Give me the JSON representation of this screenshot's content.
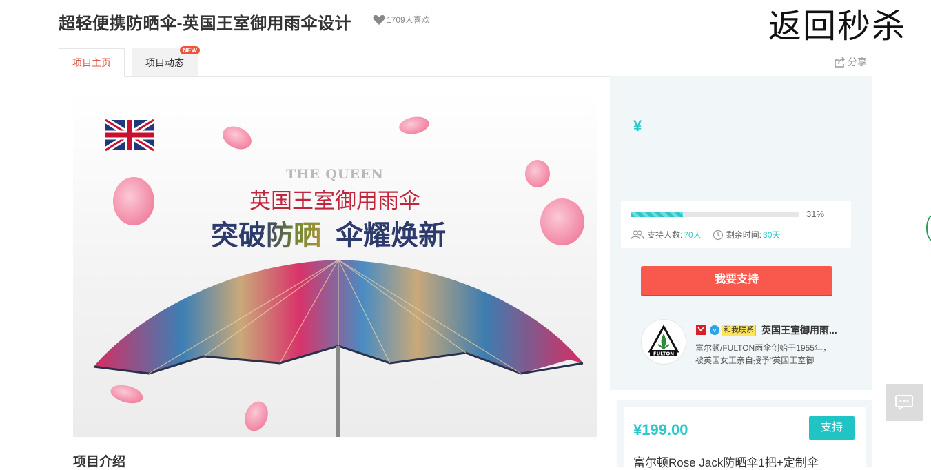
{
  "header": {
    "title": "超轻便携防晒伞-英国王室御用雨伞设计",
    "likes": "1709人喜欢",
    "back_label": "返回秒杀"
  },
  "tabs": [
    {
      "label": "项目主页",
      "active": true
    },
    {
      "label": "项目动态",
      "active": false,
      "badge": "NEW"
    }
  ],
  "share_label": "分享",
  "hero": {
    "brand_line": "THE QUEEN",
    "headline": "英国王室御用雨伞",
    "slogan_a": "突破防晒",
    "slogan_b": "伞耀焕新"
  },
  "intro_heading": "项目介绍",
  "funding": {
    "currency": "¥",
    "progress": 0.31,
    "percent_label": "31%",
    "backers_label": "支持人数:",
    "backers_value": "70人",
    "time_label": "剩余时间:",
    "time_value": "30天",
    "support_button": "我要支持"
  },
  "owner": {
    "contact_label": "和我联系",
    "name": "英国王室御用雨...",
    "description": "富尔顿/FULTON雨伞创始于1955年，被英国女王亲自授予\"英国王室御",
    "logo_text": "FULTON"
  },
  "reward": {
    "price": "¥199.00",
    "support_label": "支持",
    "description": "富尔顿Rose Jack防晒伞1把+定制伞"
  },
  "colors": {
    "accent": "#2cc7c9",
    "primary_button": "#f9594d",
    "active_tab": "#e05a46"
  }
}
